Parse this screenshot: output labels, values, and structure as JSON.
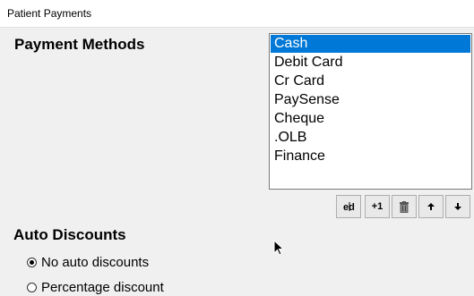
{
  "window": {
    "title": "Patient Payments"
  },
  "payment_methods": {
    "heading": "Payment Methods",
    "items": [
      {
        "label": "Cash",
        "selected": true
      },
      {
        "label": "Debit Card",
        "selected": false
      },
      {
        "label": "Cr Card",
        "selected": false
      },
      {
        "label": "PaySense",
        "selected": false
      },
      {
        "label": "Cheque",
        "selected": false
      },
      {
        "label": ".OLB",
        "selected": false
      },
      {
        "label": "Finance",
        "selected": false
      }
    ],
    "toolbar": {
      "edit_icon": "edit-icon",
      "add_label": "+1",
      "delete_icon": "trash-icon",
      "move_up_icon": "arrow-up-icon",
      "move_down_icon": "arrow-down-icon"
    }
  },
  "auto_discounts": {
    "heading": "Auto Discounts",
    "options": [
      {
        "label": "No auto discounts",
        "checked": true
      },
      {
        "label": "Percentage discount",
        "checked": false
      }
    ]
  },
  "colors": {
    "selection": "#0078d7",
    "background": "#f0f0f0"
  }
}
